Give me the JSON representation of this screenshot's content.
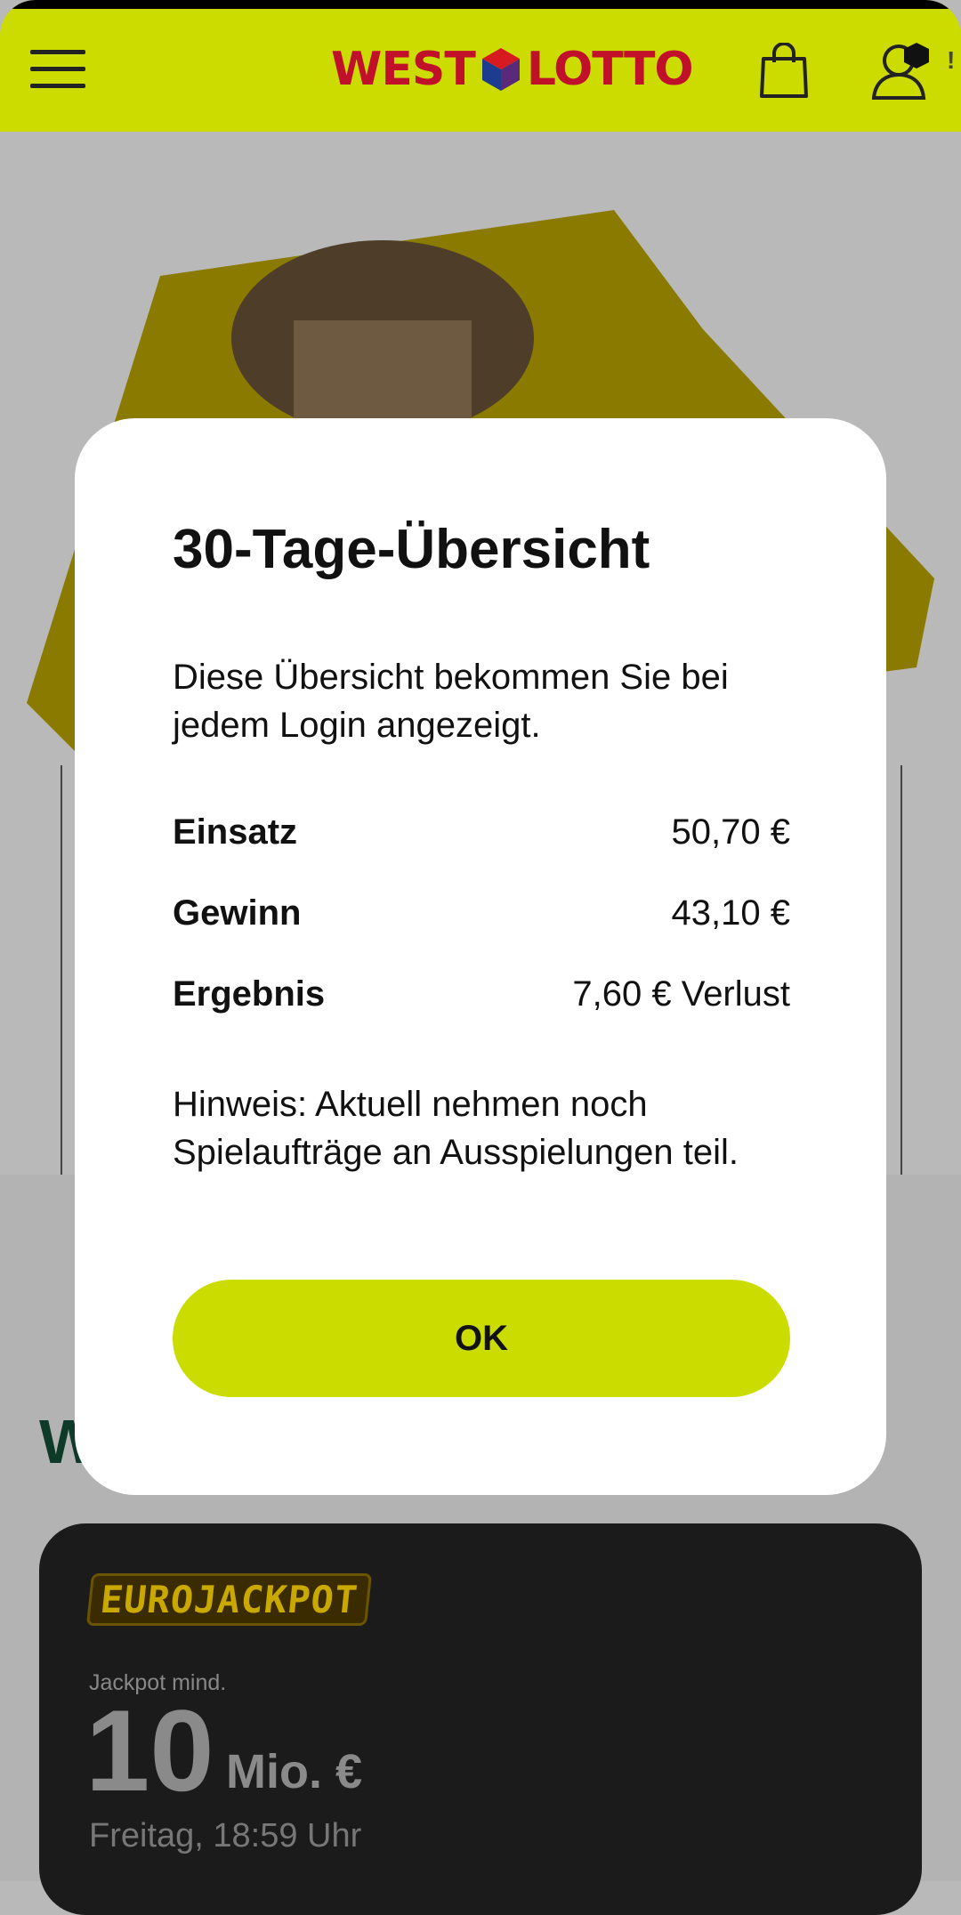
{
  "header": {
    "logo_left": "WEST",
    "logo_right": "LOTTO",
    "notice": "!"
  },
  "background": {
    "section_heading": "W",
    "eurojackpot": {
      "logo_text": "EUROJACKPOT",
      "jackpot_label": "Jackpot mind.",
      "amount": "10",
      "unit": "Mio. €",
      "draw_time": "Freitag, 18:59 Uhr"
    }
  },
  "modal": {
    "title": "30-Tage-Übersicht",
    "description": "Diese Übersicht bekommen Sie bei jedem Login angezeigt.",
    "rows": [
      {
        "label": "Einsatz",
        "value": "50,70 €"
      },
      {
        "label": "Gewinn",
        "value": "43,10 €"
      },
      {
        "label": "Ergebnis",
        "value": "7,60 € Verlust"
      }
    ],
    "note": "Hinweis: Aktuell nehmen noch Spielaufträge an Ausspielungen teil.",
    "ok_label": "OK"
  },
  "colors": {
    "brand_yellow": "#ccdc00",
    "logo_red": "#c0102a",
    "overlay": "#b9b9b9"
  },
  "icons": [
    "menu-icon",
    "shopping-bag-icon",
    "user-icon",
    "logo-cube-icon"
  ]
}
